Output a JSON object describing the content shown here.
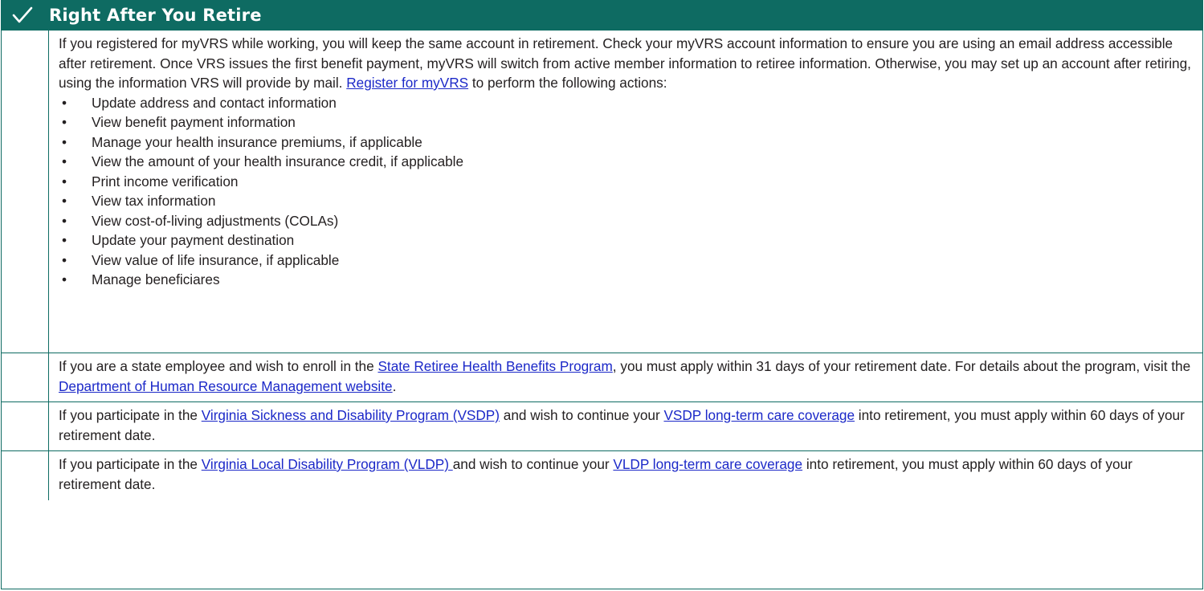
{
  "header": {
    "title": "Right After You Retire",
    "icon": "checkmark-icon",
    "color": "#0e6b62"
  },
  "row1": {
    "intro": "If you registered for myVRS while working, you will keep the same account in retirement. Check your myVRS account information to ensure you are using an email address accessible after retirement. Once VRS issues the first benefit payment, myVRS will switch from active member information to retiree information. Otherwise, you may set up an account after retiring, using the information VRS will provide by mail. ",
    "link": "Register for myVRS",
    "after_link": " to perform the following actions:",
    "actions": [
      "Update address and contact information",
      "View benefit payment information",
      "Manage your health insurance premiums, if applicable",
      "View the amount of your health insurance credit, if applicable",
      "Print income verification",
      "View tax information",
      "View cost-of-living adjustments (COLAs)",
      "Update your payment destination",
      "View value of life insurance, if applicable",
      "Manage beneficiares"
    ]
  },
  "row2": {
    "t1": "If you are a state employee and wish to enroll in the ",
    "link1": "State Retiree Health Benefits Program",
    "t2": ", you must apply within 31 days of your retirement date. For details about the program, visit the ",
    "link2": "Department of Human Resource Management website",
    "t3": "."
  },
  "row3": {
    "t1": "If you participate in the ",
    "link1": "Virginia Sickness and Disability Program (VSDP)",
    "t2": " and wish to continue your ",
    "link2": "VSDP long-term care coverage",
    "t3": " into retirement, you must apply within 60 days of your retirement date."
  },
  "row4": {
    "t1": "If you participate in the ",
    "link1": "Virginia Local Disability Program (VLDP) ",
    "t2": "and wish to continue your ",
    "link2": "VLDP long-term care coverage",
    "t3": " into retirement, you must apply within 60 days of your retirement date."
  },
  "colors": {
    "link": "#1b28c8",
    "border": "#0e6b62"
  }
}
